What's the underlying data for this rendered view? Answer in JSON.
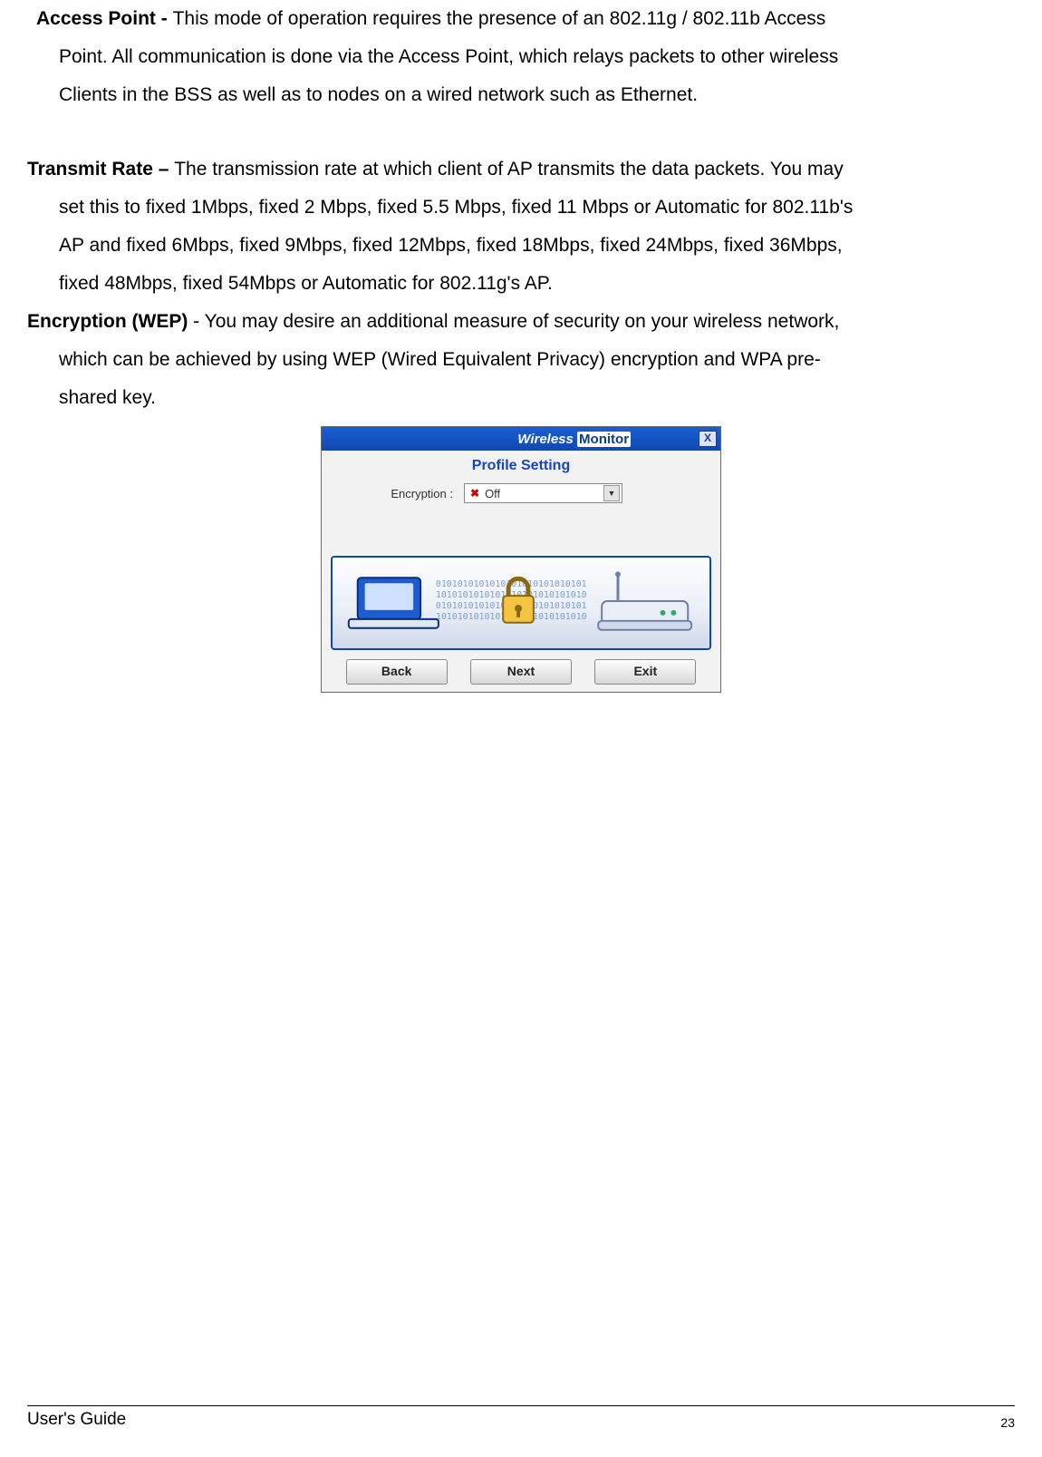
{
  "paragraphs": {
    "access_point": {
      "label": "Access Point - ",
      "line1_rest": "This mode of operation requires the presence of an 802.11g / 802.11b  Access",
      "line2": "Point.  All communication is done via the Access Point, which relays packets to other wireless",
      "line3": "Clients in the BSS as well as to nodes on a wired network such as Ethernet."
    },
    "transmit_rate": {
      "label": "Transmit Rate – ",
      "line1_rest": "The transmission rate at which client of AP transmits the data packets. You may",
      "line2": "set this to fixed 1Mbps, fixed 2 Mbps, fixed 5.5 Mbps, fixed 11 Mbps or Automatic for 802.11b's",
      "line3": "AP and fixed 6Mbps, fixed 9Mbps, fixed 12Mbps, fixed 18Mbps, fixed 24Mbps, fixed 36Mbps,",
      "line4": "fixed 48Mbps, fixed 54Mbps or Automatic for 802.11g's AP."
    },
    "encryption": {
      "label": "Encryption (WEP) ",
      "line1_rest": "- You may desire an additional measure of security on your wireless network,",
      "line2": "which can be achieved by using WEP (Wired Equivalent Privacy) encryption and WPA pre-",
      "line3": "shared key."
    }
  },
  "dialog": {
    "title_prefix": "Wireless ",
    "title_suffix": "Monitor",
    "close_glyph": "X",
    "subheader": "Profile Setting",
    "encryption_label": "Encryption :",
    "encryption_value": "Off",
    "buttons": {
      "back": "Back",
      "next": "Next",
      "exit": "Exit"
    }
  },
  "footer": {
    "guide": "User's Guide",
    "page": "23"
  }
}
